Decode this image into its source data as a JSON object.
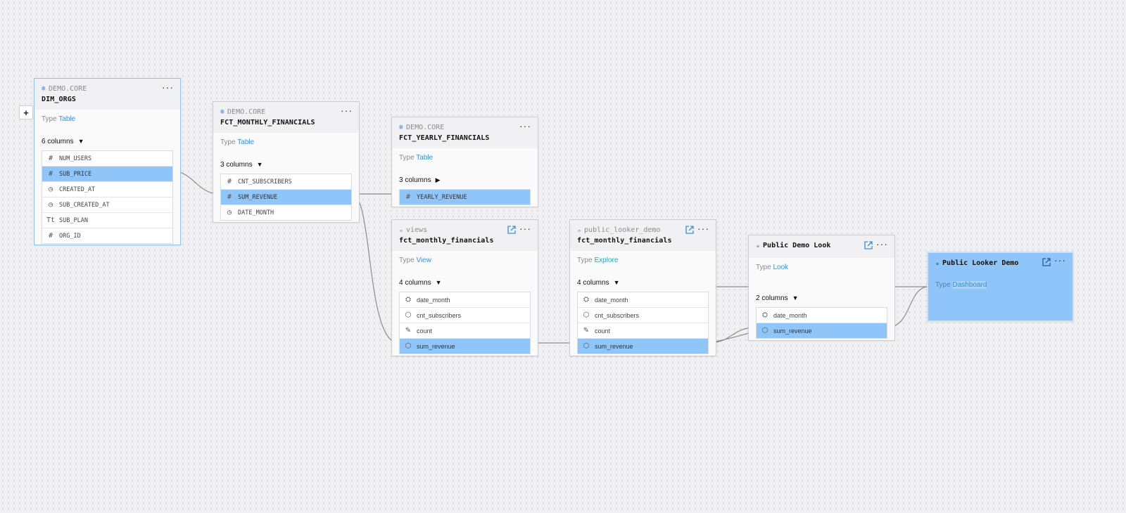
{
  "toolbar": {
    "add_label": "+"
  },
  "type_label": "Type",
  "nodes": {
    "dim_orgs": {
      "source": "DEMO.CORE",
      "title": "DIM_ORGS",
      "type": "Table",
      "columns_label": "6 columns",
      "caret": "▼",
      "columns": [
        {
          "icon": "#",
          "name": "NUM_USERS"
        },
        {
          "icon": "#",
          "name": "SUB_PRICE"
        },
        {
          "icon": "◷",
          "name": "CREATED_AT"
        },
        {
          "icon": "◷",
          "name": "SUB_CREATED_AT"
        },
        {
          "icon": "Tt",
          "name": "SUB_PLAN"
        },
        {
          "icon": "#",
          "name": "ORG_ID"
        }
      ]
    },
    "fct_monthly": {
      "source": "DEMO.CORE",
      "title": "FCT_MONTHLY_FINANCIALS",
      "type": "Table",
      "columns_label": "3 columns",
      "caret": "▼",
      "columns": [
        {
          "icon": "#",
          "name": "CNT_SUBSCRIBERS"
        },
        {
          "icon": "#",
          "name": "SUM_REVENUE"
        },
        {
          "icon": "◷",
          "name": "DATE_MONTH"
        }
      ]
    },
    "fct_yearly": {
      "source": "DEMO.CORE",
      "title": "FCT_YEARLY_FINANCIALS",
      "type": "Table",
      "columns_label": "3 columns",
      "caret": "▶",
      "columns": [
        {
          "icon": "#",
          "name": "YEARLY_REVENUE"
        }
      ]
    },
    "views": {
      "source": "views",
      "title": "fct_monthly_financials",
      "type": "View",
      "columns_label": "4 columns",
      "caret": "▼",
      "columns": [
        {
          "icon": "⛭",
          "name": "date_month"
        },
        {
          "icon": "⬡",
          "name": "cnt_subscribers"
        },
        {
          "icon": "✎",
          "name": "count"
        },
        {
          "icon": "⬡",
          "name": "sum_revenue"
        }
      ]
    },
    "explore": {
      "source": "public_looker_demo",
      "title": "fct_monthly_financials",
      "type": "Explore",
      "columns_label": "4 columns",
      "caret": "▼",
      "columns": [
        {
          "icon": "⛭",
          "name": "date_month"
        },
        {
          "icon": "⬡",
          "name": "cnt_subscribers"
        },
        {
          "icon": "✎",
          "name": "count"
        },
        {
          "icon": "⬡",
          "name": "sum_revenue"
        }
      ]
    },
    "look": {
      "title": "Public Demo Look",
      "type": "Look",
      "columns_label": "2 columns",
      "caret": "▼",
      "columns": [
        {
          "icon": "⛭",
          "name": "date_month"
        },
        {
          "icon": "⬡",
          "name": "sum_revenue"
        }
      ]
    },
    "dashboard": {
      "title": "Public Looker Demo",
      "type": "Dashboard"
    }
  },
  "icons": {
    "warehouse": "snowflake-icon",
    "looker": "looker-icon",
    "external": "external-link-icon",
    "menu": "more-icon"
  },
  "colors": {
    "highlight": "#8fc5f8",
    "accent": "#3a8ee6",
    "edge": "#8d8c91"
  }
}
